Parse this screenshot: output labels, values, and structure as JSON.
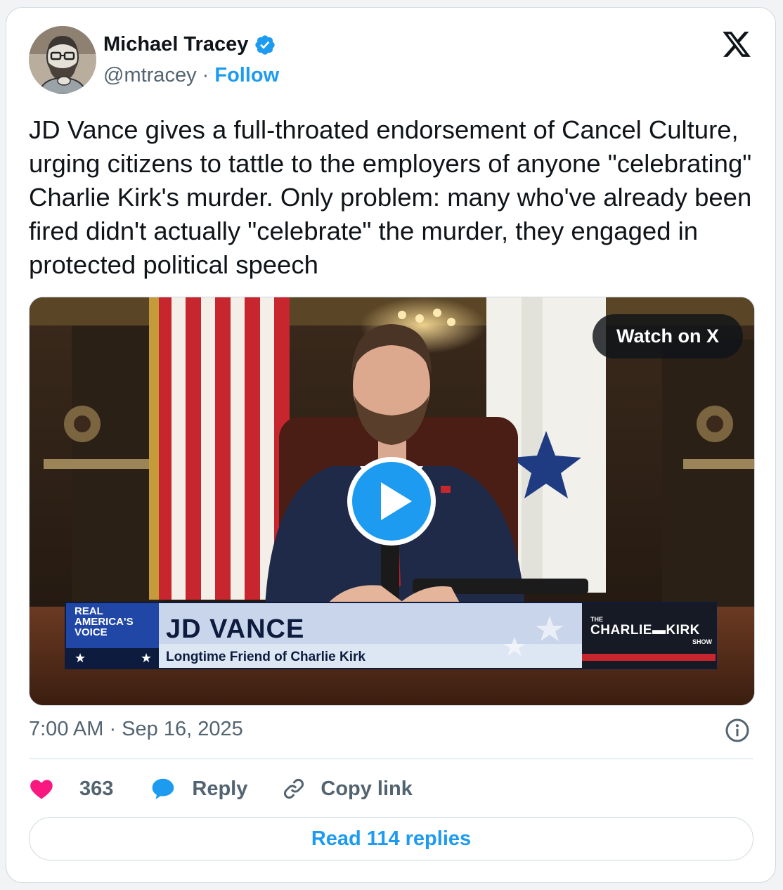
{
  "author": {
    "name": "Michael Tracey",
    "handle": "@mtracey",
    "separator": " · ",
    "follow_label": "Follow"
  },
  "tweet": {
    "text": "JD Vance gives a full-throated endorsement of Cancel Culture, urging citizens to tattle to the employers of anyone \"celebrating\" Charlie Kirk's murder. Only problem: many who've already been fired didn't actually \"celebrate\" the murder, they engaged in protected political speech",
    "timestamp": "7:00 AM · Sep 16, 2025"
  },
  "media": {
    "watch_label": "Watch on X",
    "lower_third": {
      "name": "JD VANCE",
      "subtitle": "Longtime Friend of Charlie Kirk",
      "network_line1": "REAL",
      "network_line2": "AMERICA'S",
      "network_line3": "VOICE",
      "show_the": "THE",
      "show_name": "CHARLIE▬KIRK",
      "show_suffix": "SHOW"
    }
  },
  "actions": {
    "likes": "363",
    "reply_label": "Reply",
    "copy_label": "Copy link"
  },
  "read_replies_label": "Read 114 replies",
  "colors": {
    "accent": "#1d9bf0",
    "like": "#f91880",
    "text": "#0f1419",
    "secondary": "#536471",
    "border": "#cfd9de"
  },
  "icons": [
    "verified-badge-icon",
    "x-logo-icon",
    "play-icon",
    "info-icon",
    "heart-icon",
    "reply-bubble-icon",
    "link-icon"
  ]
}
